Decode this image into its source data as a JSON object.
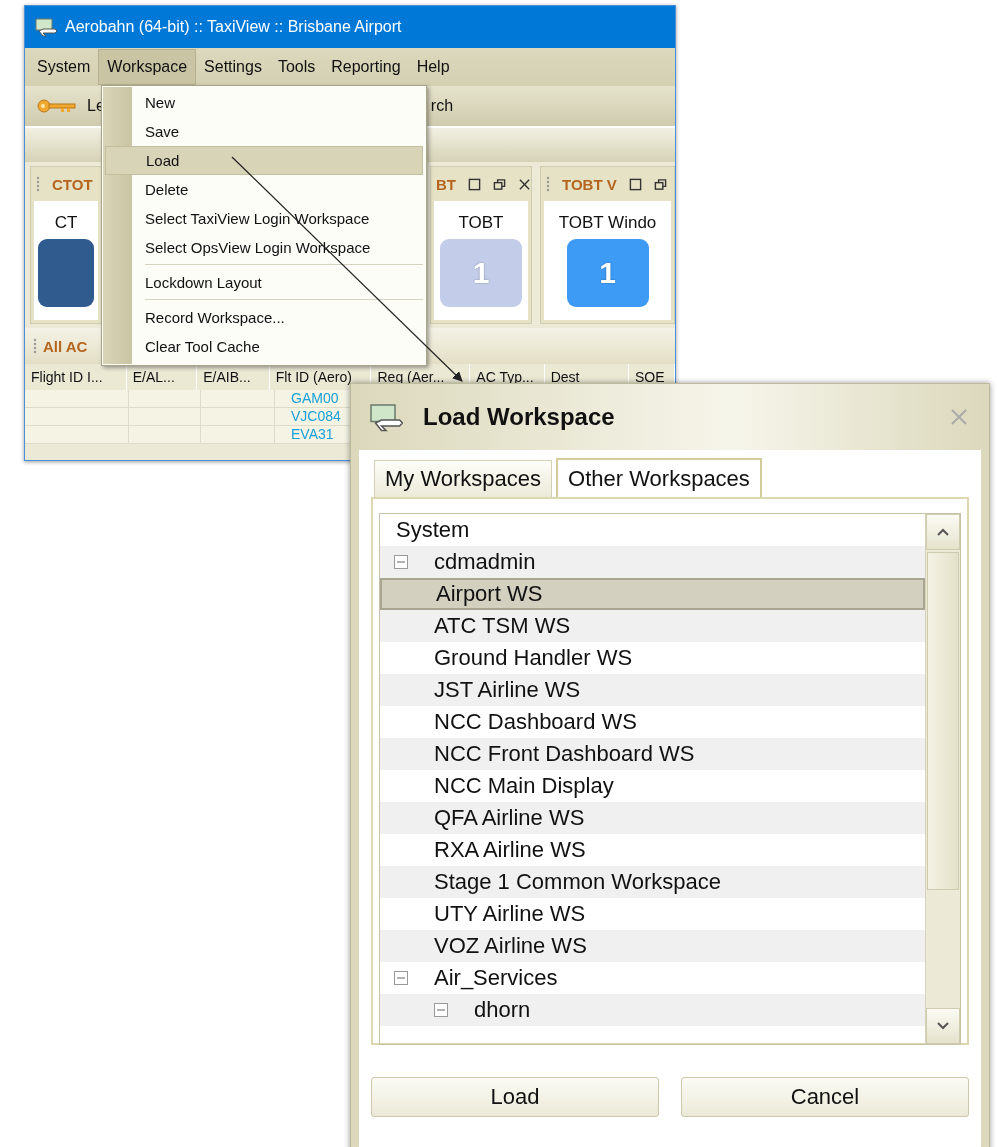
{
  "app_window": {
    "title": "Aerobahn (64-bit) :: TaxiView :: Brisbane Airport",
    "menu_bar": [
      {
        "label": "System",
        "selected": false
      },
      {
        "label": "Workspace",
        "selected": true
      },
      {
        "label": "Settings",
        "selected": false
      },
      {
        "label": "Tools",
        "selected": false
      },
      {
        "label": "Reporting",
        "selected": false
      },
      {
        "label": "Help",
        "selected": false
      }
    ],
    "toolbar": [
      "Le",
      "rch"
    ],
    "panels": [
      {
        "title": "CTOT",
        "label": "CT",
        "color": "#2f5b8f",
        "controls": false,
        "closable": false
      },
      {
        "title": "BT",
        "label": "TOBT",
        "value": "1",
        "color": "#c3cdea",
        "controls": true,
        "closable": true
      },
      {
        "title": "TOBT V",
        "label": "TOBT Windo",
        "value": "1",
        "color": "#3d9bf5",
        "controls": true,
        "closable": false
      }
    ],
    "grid": {
      "title": "All AC",
      "columns": [
        "Flight ID I...",
        "E/AL...",
        "E/AIB...",
        "Flt ID (Aero)",
        "Reg (Aer...",
        "AC Typ...",
        "Dest",
        "SOE"
      ],
      "rows": [
        [
          "",
          "",
          "",
          "GAM00"
        ],
        [
          "",
          "",
          "",
          "VJC084"
        ],
        [
          "",
          "",
          "",
          "EVA31"
        ]
      ]
    }
  },
  "workspace_menu": {
    "groups": [
      [
        {
          "label": "New",
          "selected": false
        },
        {
          "label": "Save",
          "selected": false
        },
        {
          "label": "Load",
          "selected": true
        },
        {
          "label": "Delete",
          "selected": false
        },
        {
          "label": "Select TaxiView Login Workspace",
          "selected": false
        },
        {
          "label": "Select OpsView Login Workspace",
          "selected": false
        }
      ],
      [
        {
          "label": "Lockdown Layout",
          "selected": false
        }
      ],
      [
        {
          "label": "Record Workspace...",
          "selected": false
        },
        {
          "label": "Clear Tool Cache",
          "selected": false
        }
      ]
    ]
  },
  "dialog": {
    "title": "Load Workspace",
    "tabs": [
      {
        "label": "My Workspaces",
        "selected": false
      },
      {
        "label": "Other Workspaces",
        "selected": true
      }
    ],
    "tree": [
      {
        "label": "System",
        "selected": false
      },
      {
        "label": "cdmadmin",
        "selected": false,
        "expanded": true,
        "children": [
          {
            "label": "Airport WS",
            "selected": true
          },
          {
            "label": "ATC TSM WS",
            "selected": false
          },
          {
            "label": "Ground Handler WS",
            "selected": false
          },
          {
            "label": "JST Airline WS",
            "selected": false
          },
          {
            "label": "NCC Dashboard WS",
            "selected": false
          },
          {
            "label": "NCC Front Dashboard WS",
            "selected": false
          },
          {
            "label": "NCC Main Display",
            "selected": false
          },
          {
            "label": "QFA Airline WS",
            "selected": false
          },
          {
            "label": "RXA Airline WS",
            "selected": false
          },
          {
            "label": "Stage 1 Common Workspace",
            "selected": false
          },
          {
            "label": "UTY Airline WS",
            "selected": false
          },
          {
            "label": "VOZ Airline WS",
            "selected": false
          }
        ]
      },
      {
        "label": "Air_Services",
        "selected": false,
        "expanded": true,
        "children": [
          {
            "label": "dhorn",
            "selected": false,
            "expanded": true
          }
        ]
      }
    ],
    "buttons": [
      "Load",
      "Cancel"
    ]
  }
}
